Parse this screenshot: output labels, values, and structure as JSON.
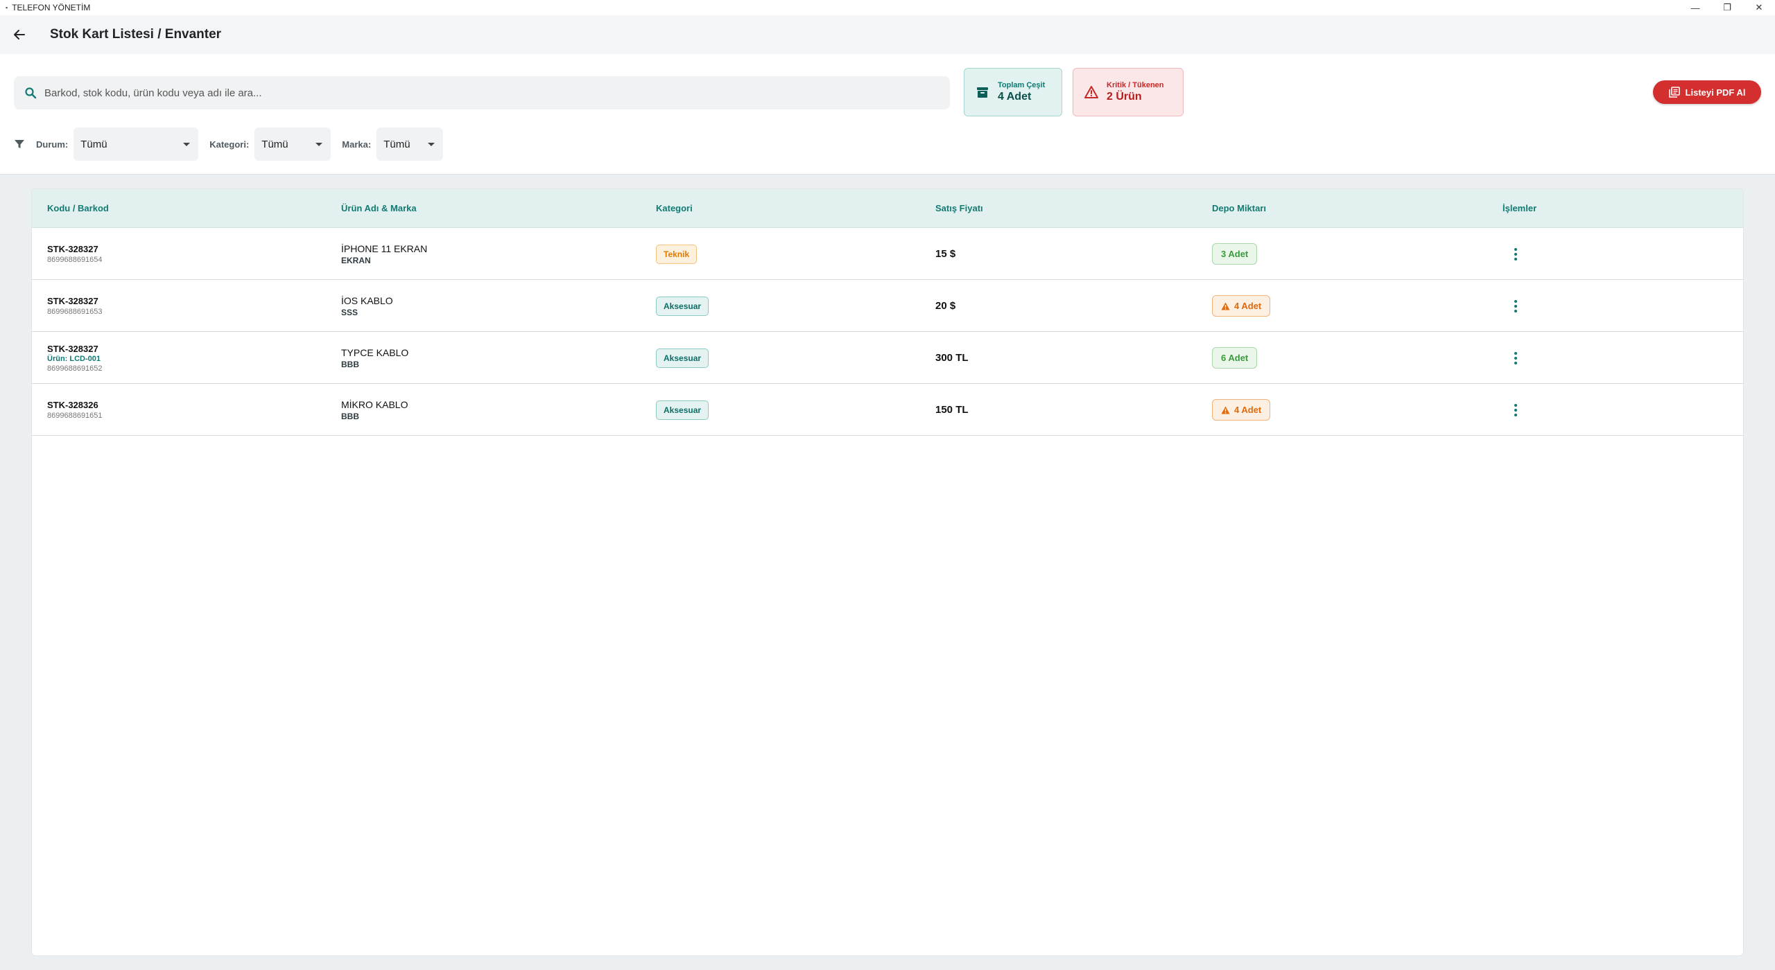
{
  "window": {
    "title": "TELEFON YÖNETİM",
    "controls": [
      "—",
      "❐",
      "✕"
    ]
  },
  "appbar": {
    "back_icon": "arrow-left-icon",
    "title": "Stok Kart Listesi / Envanter"
  },
  "search": {
    "placeholder": "Barkod, stok kodu, ürün kodu veya adı ile ara...",
    "value": ""
  },
  "stats": {
    "total": {
      "label": "Toplam Çeşit",
      "value": "4 Adet",
      "icon": "archive-icon"
    },
    "critical": {
      "label": "Kritik / Tükenen",
      "value": "2 Ürün",
      "icon": "warning-icon"
    }
  },
  "pdf_button": {
    "label": "Listeyi PDF Al",
    "icon": "pdf-icon"
  },
  "filters": {
    "durum": {
      "label": "Durum:",
      "value": "Tümü"
    },
    "kategori": {
      "label": "Kategori:",
      "value": "Tümü"
    },
    "marka": {
      "label": "Marka:",
      "value": "Tümü"
    }
  },
  "table": {
    "columns": [
      "Kodu / Barkod",
      "Ürün Adı & Marka",
      "Kategori",
      "Satış Fiyatı",
      "Depo Miktarı",
      "İşlemler"
    ],
    "rows": [
      {
        "code": "STK-328327",
        "product_code": "",
        "barcode": "8699688691654",
        "name": "İPHONE 11 EKRAN",
        "brand": "EKRAN",
        "category": "Teknik",
        "category_style": "warn",
        "price": "15 $",
        "stock": "3 Adet",
        "stock_low": false
      },
      {
        "code": "STK-328327",
        "product_code": "",
        "barcode": "8699688691653",
        "name": "İOS KABLO",
        "brand": "SSS",
        "category": "Aksesuar",
        "category_style": "teal",
        "price": "20 $",
        "stock": "4 Adet",
        "stock_low": true
      },
      {
        "code": "STK-328327",
        "product_code": "Ürün: LCD-001",
        "barcode": "8699688691652",
        "name": "TYPCE KABLO",
        "brand": "BBB",
        "category": "Aksesuar",
        "category_style": "teal",
        "price": "300 TL",
        "stock": "6 Adet",
        "stock_low": false
      },
      {
        "code": "STK-328326",
        "product_code": "",
        "barcode": "8699688691651",
        "name": "MİKRO KABLO",
        "brand": "BBB",
        "category": "Aksesuar",
        "category_style": "teal",
        "price": "150 TL",
        "stock": "4 Adet",
        "stock_low": true
      }
    ]
  },
  "colors": {
    "accent": "#127a72",
    "danger": "#d32f2f",
    "warning": "#e07a00",
    "success": "#3a9a3e"
  }
}
